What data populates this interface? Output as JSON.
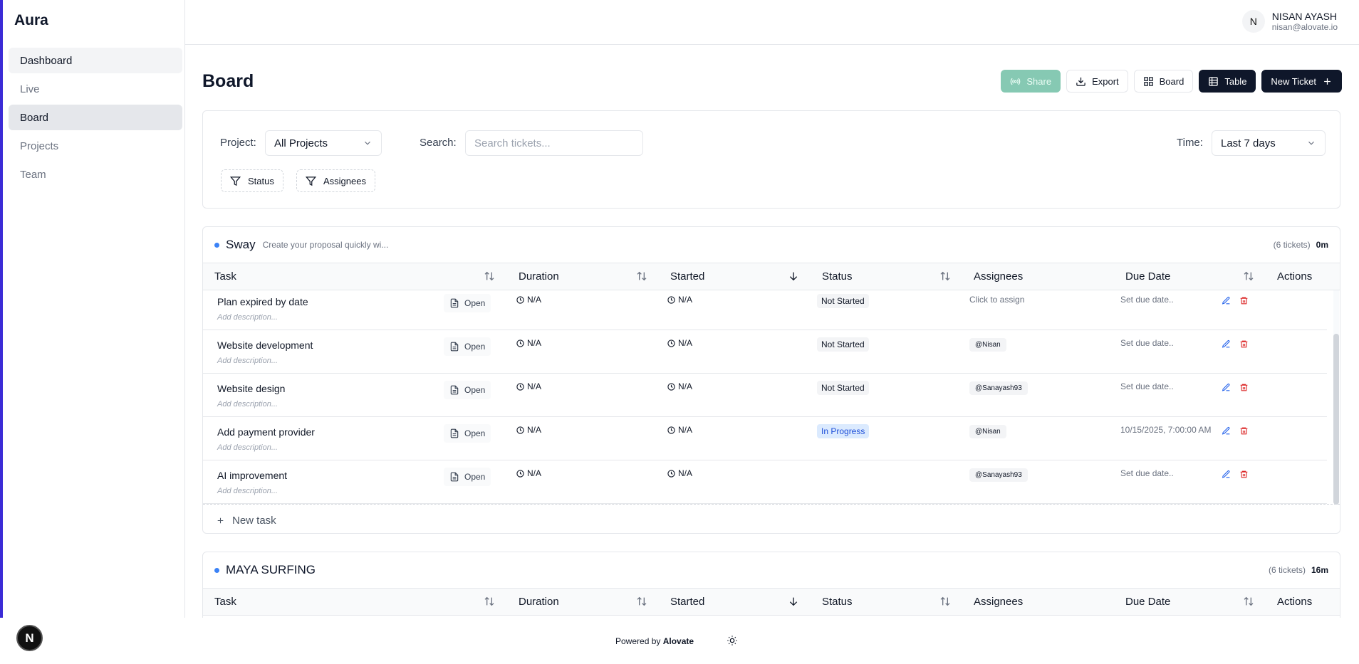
{
  "app": {
    "name": "Aura"
  },
  "sidebar": {
    "items": [
      {
        "label": "Dashboard"
      },
      {
        "label": "Live"
      },
      {
        "label": "Board"
      },
      {
        "label": "Projects"
      },
      {
        "label": "Team"
      }
    ]
  },
  "user": {
    "initial": "N",
    "name": "NISAN AYASH",
    "email": "nisan@alovate.io"
  },
  "page": {
    "title": "Board"
  },
  "toolbar": {
    "share": "Share",
    "export": "Export",
    "board": "Board",
    "table": "Table",
    "new_ticket": "New Ticket"
  },
  "filters": {
    "project_label": "Project:",
    "project_value": "All Projects",
    "search_label": "Search:",
    "search_placeholder": "Search tickets...",
    "time_label": "Time:",
    "time_value": "Last 7 days",
    "status_chip": "Status",
    "assignees_chip": "Assignees"
  },
  "columns": {
    "task": "Task",
    "duration": "Duration",
    "started": "Started",
    "status": "Status",
    "assignees": "Assignees",
    "due": "Due Date",
    "actions": "Actions"
  },
  "groups": [
    {
      "name": "Sway",
      "description": "Create your proposal quickly wi...",
      "count": "(6 tickets)",
      "time": "0m",
      "tasks": [
        {
          "title": "Plan expired by date",
          "desc": "Add description...",
          "open": "Open",
          "duration": "N/A",
          "started": "N/A",
          "status": "Not Started",
          "assignee": "Click to assign",
          "due": "Set due date.."
        },
        {
          "title": "Website development",
          "desc": "Add description...",
          "open": "Open",
          "duration": "N/A",
          "started": "N/A",
          "status": "Not Started",
          "assignee": "@Nisan",
          "due": "Set due date.."
        },
        {
          "title": "Website design",
          "desc": "Add description...",
          "open": "Open",
          "duration": "N/A",
          "started": "N/A",
          "status": "Not Started",
          "assignee": "@Sanayash93",
          "due": "Set due date.."
        },
        {
          "title": "Add payment provider",
          "desc": "Add description...",
          "open": "Open",
          "duration": "N/A",
          "started": "N/A",
          "status": "In Progress",
          "assignee": "@Nisan",
          "due": "10/15/2025, 7:00:00 AM"
        },
        {
          "title": "AI improvement",
          "desc": "Add description...",
          "open": "Open",
          "duration": "N/A",
          "started": "N/A",
          "status": "",
          "assignee": "@Sanayash93",
          "due": "Set due date.."
        }
      ],
      "new_task": "New task"
    },
    {
      "name": "MAYA SURFING",
      "count": "(6 tickets)",
      "time": "16m"
    }
  ],
  "footer": {
    "powered_prefix": "Powered by",
    "powered_brand": "Alovate"
  },
  "floating_badge": "N"
}
